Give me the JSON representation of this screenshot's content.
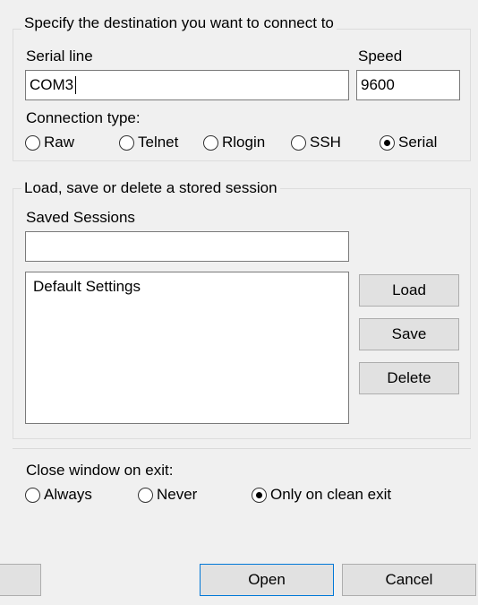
{
  "destination": {
    "group_title": "Specify the destination you want to connect to",
    "serial_line_label": "Serial line",
    "serial_line_value": "COM3",
    "speed_label": "Speed",
    "speed_value": "9600",
    "connection_type_label": "Connection type:",
    "connection_types": [
      {
        "label": "Raw",
        "checked": false
      },
      {
        "label": "Telnet",
        "checked": false
      },
      {
        "label": "Rlogin",
        "checked": false
      },
      {
        "label": "SSH",
        "checked": false
      },
      {
        "label": "Serial",
        "checked": true
      }
    ]
  },
  "sessions": {
    "group_title": "Load, save or delete a stored session",
    "saved_sessions_label": "Saved Sessions",
    "saved_sessions_value": "",
    "list_items": [
      "Default Settings"
    ],
    "load_label": "Load",
    "save_label": "Save",
    "delete_label": "Delete"
  },
  "close_window": {
    "label": "Close window on exit:",
    "options": [
      {
        "label": "Always",
        "checked": false
      },
      {
        "label": "Never",
        "checked": false
      },
      {
        "label": "Only on clean exit",
        "checked": true
      }
    ]
  },
  "footer": {
    "about_label": "",
    "open_label": "Open",
    "cancel_label": "Cancel"
  }
}
